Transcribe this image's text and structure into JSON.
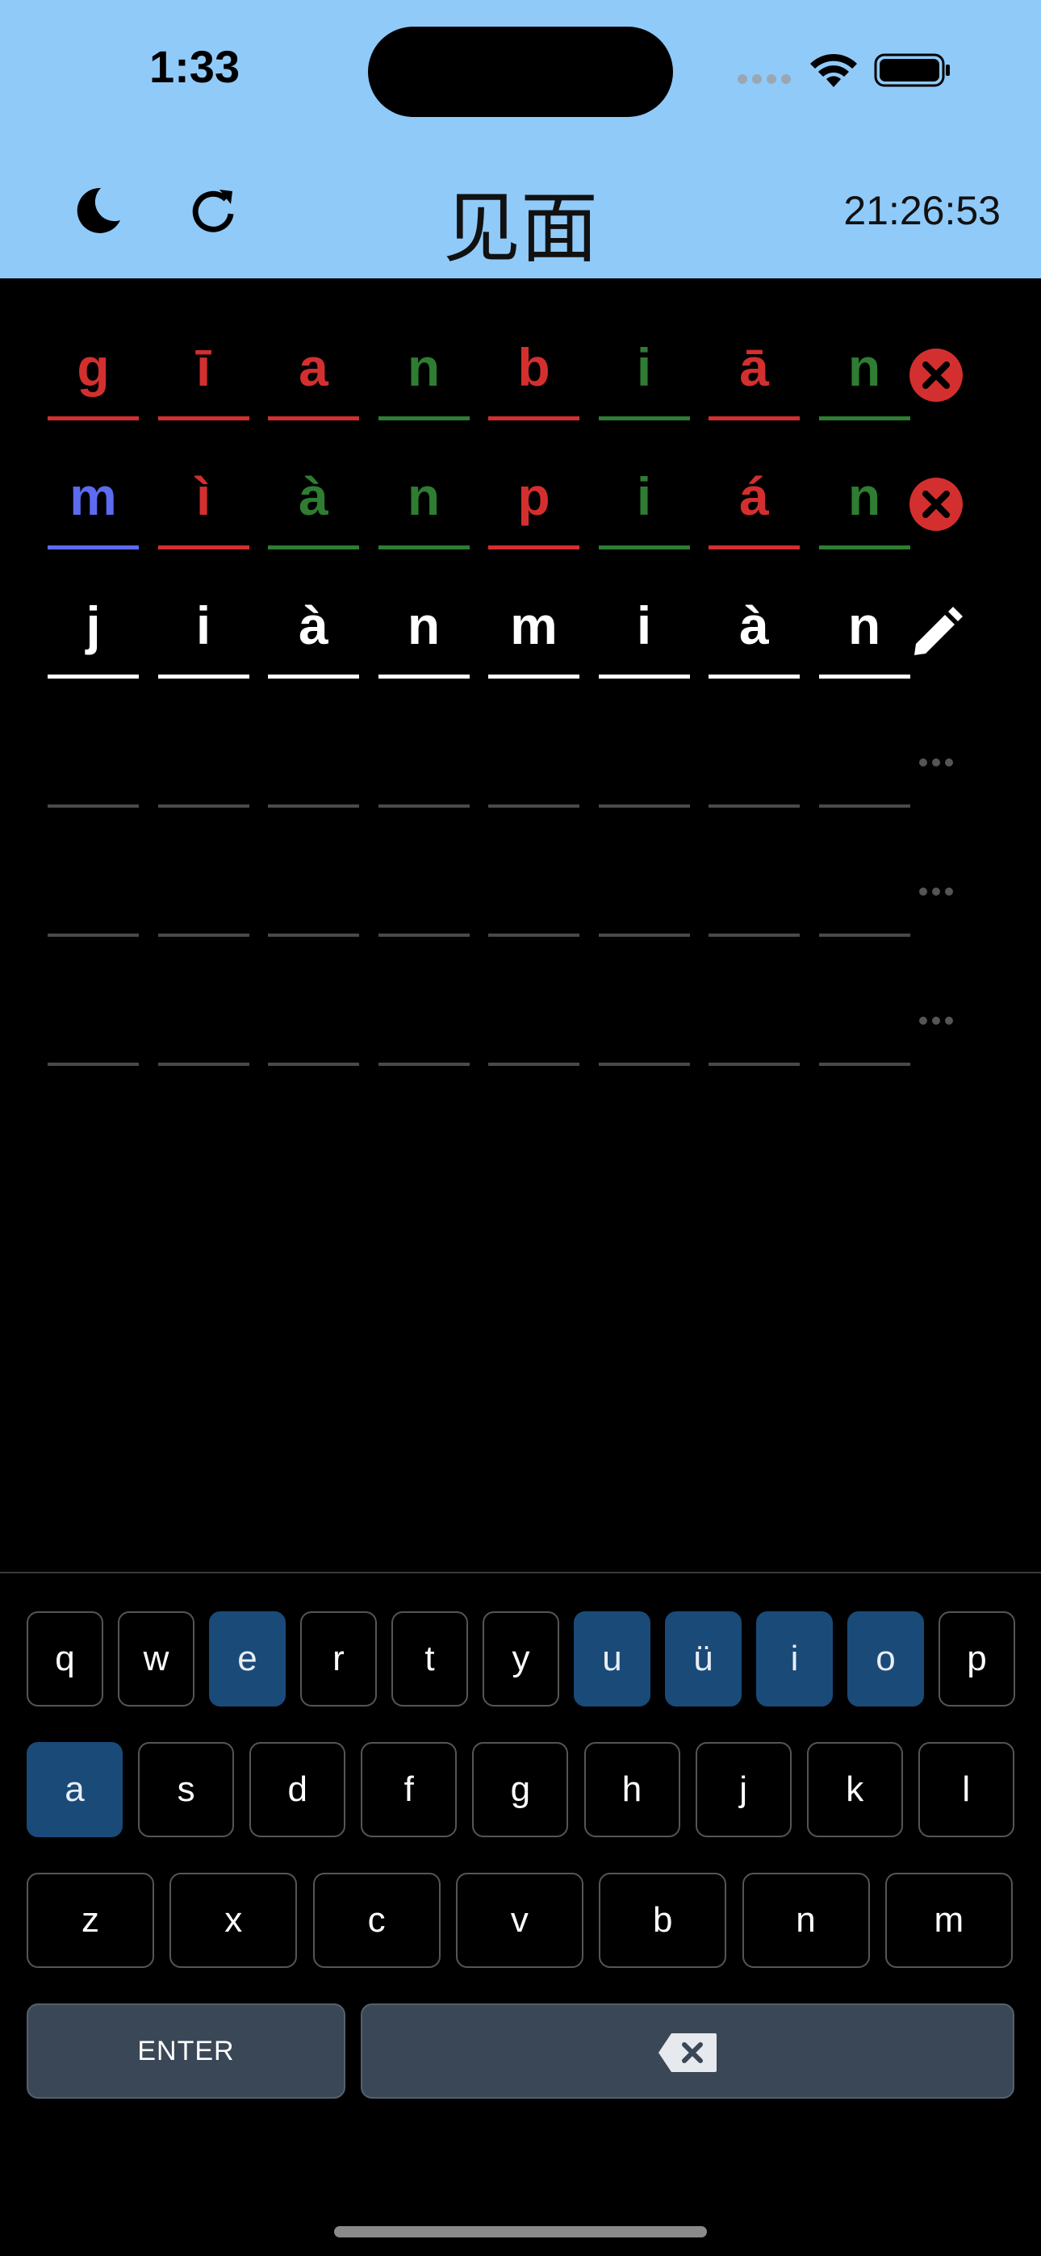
{
  "status": {
    "time": "1:33"
  },
  "header": {
    "title": "见面",
    "timer": "21:26:53"
  },
  "grid": {
    "rows": [
      {
        "letters": [
          {
            "char": "g",
            "state": "red"
          },
          {
            "char": "ī",
            "state": "red"
          },
          {
            "char": "a",
            "state": "red"
          },
          {
            "char": "n",
            "state": "green"
          },
          {
            "char": "b",
            "state": "red"
          },
          {
            "char": "i",
            "state": "green"
          },
          {
            "char": "ā",
            "state": "red"
          },
          {
            "char": "n",
            "state": "green"
          }
        ],
        "icon": "x-circle-icon"
      },
      {
        "letters": [
          {
            "char": "m",
            "state": "blue"
          },
          {
            "char": "ì",
            "state": "red"
          },
          {
            "char": "à",
            "state": "green"
          },
          {
            "char": "n",
            "state": "green"
          },
          {
            "char": "p",
            "state": "red"
          },
          {
            "char": "i",
            "state": "green"
          },
          {
            "char": "á",
            "state": "red"
          },
          {
            "char": "n",
            "state": "green"
          }
        ],
        "icon": "x-circle-icon"
      },
      {
        "letters": [
          {
            "char": "j",
            "state": "white"
          },
          {
            "char": "i",
            "state": "white"
          },
          {
            "char": "à",
            "state": "white"
          },
          {
            "char": "n",
            "state": "white"
          },
          {
            "char": "m",
            "state": "white"
          },
          {
            "char": "i",
            "state": "white"
          },
          {
            "char": "à",
            "state": "white"
          },
          {
            "char": "n",
            "state": "white"
          }
        ],
        "icon": "pencil-icon"
      },
      {
        "letters": [],
        "icon": "ellipsis-icon"
      },
      {
        "letters": [],
        "icon": "ellipsis-icon"
      },
      {
        "letters": [],
        "icon": "ellipsis-icon"
      }
    ]
  },
  "keyboard": {
    "rows": [
      [
        {
          "k": "q"
        },
        {
          "k": "w"
        },
        {
          "k": "e",
          "hl": true
        },
        {
          "k": "r"
        },
        {
          "k": "t"
        },
        {
          "k": "y"
        },
        {
          "k": "u",
          "hl": true
        },
        {
          "k": "ü",
          "hl": true
        },
        {
          "k": "i",
          "hl": true
        },
        {
          "k": "o",
          "hl": true
        },
        {
          "k": "p"
        }
      ],
      [
        {
          "k": "a",
          "hl": true
        },
        {
          "k": "s"
        },
        {
          "k": "d"
        },
        {
          "k": "f"
        },
        {
          "k": "g"
        },
        {
          "k": "h"
        },
        {
          "k": "j"
        },
        {
          "k": "k"
        },
        {
          "k": "l"
        }
      ],
      [
        {
          "k": "z"
        },
        {
          "k": "x"
        },
        {
          "k": "c"
        },
        {
          "k": "v"
        },
        {
          "k": "b"
        },
        {
          "k": "n"
        },
        {
          "k": "m"
        }
      ]
    ],
    "enter_label": "ENTER",
    "backspace_icon": "backspace-icon"
  },
  "colors": {
    "header_bg": "#90caf9",
    "red": "#d32f2f",
    "green": "#2e7d32",
    "blue": "#5c6bf0",
    "highlight_key": "#1a4a78",
    "wide_key": "#3a4756"
  }
}
